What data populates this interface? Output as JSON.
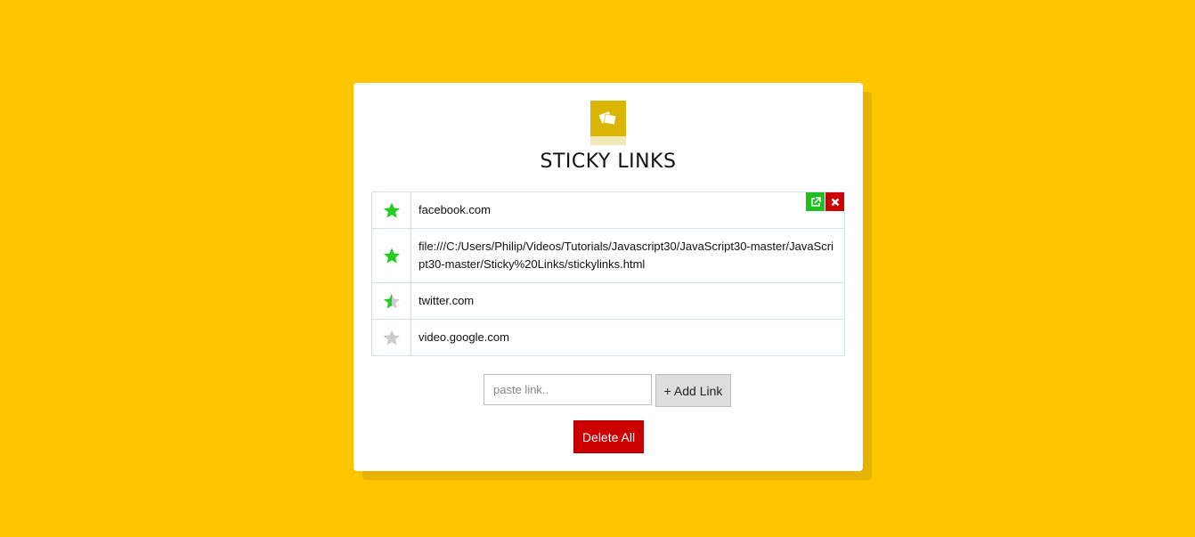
{
  "app": {
    "title": "STICKY LINKS",
    "background_color": "#ffc600"
  },
  "links": [
    {
      "url": "facebook.com",
      "rating": 1.0,
      "actions_visible": true
    },
    {
      "url": "file:///C:/Users/Philip/Videos/Tutorials/Javascript30/JavaScript30-master/JavaScript30-master/Sticky%20Links/stickylinks.html",
      "rating": 1.0,
      "actions_visible": false
    },
    {
      "url": "twitter.com",
      "rating": 0.5,
      "actions_visible": false
    },
    {
      "url": "video.google.com",
      "rating": 0.1,
      "actions_visible": false
    }
  ],
  "row_actions": {
    "open_icon": "external-link-icon",
    "delete_icon": "close-icon"
  },
  "input": {
    "placeholder": "paste link..",
    "value": ""
  },
  "buttons": {
    "add_label": "+ Add Link",
    "delete_all_label": "Delete All"
  },
  "colors": {
    "star_filled": "#22cc22",
    "star_empty": "#cccccc",
    "open_button": "#20c020",
    "delete_button": "#cc0000"
  }
}
